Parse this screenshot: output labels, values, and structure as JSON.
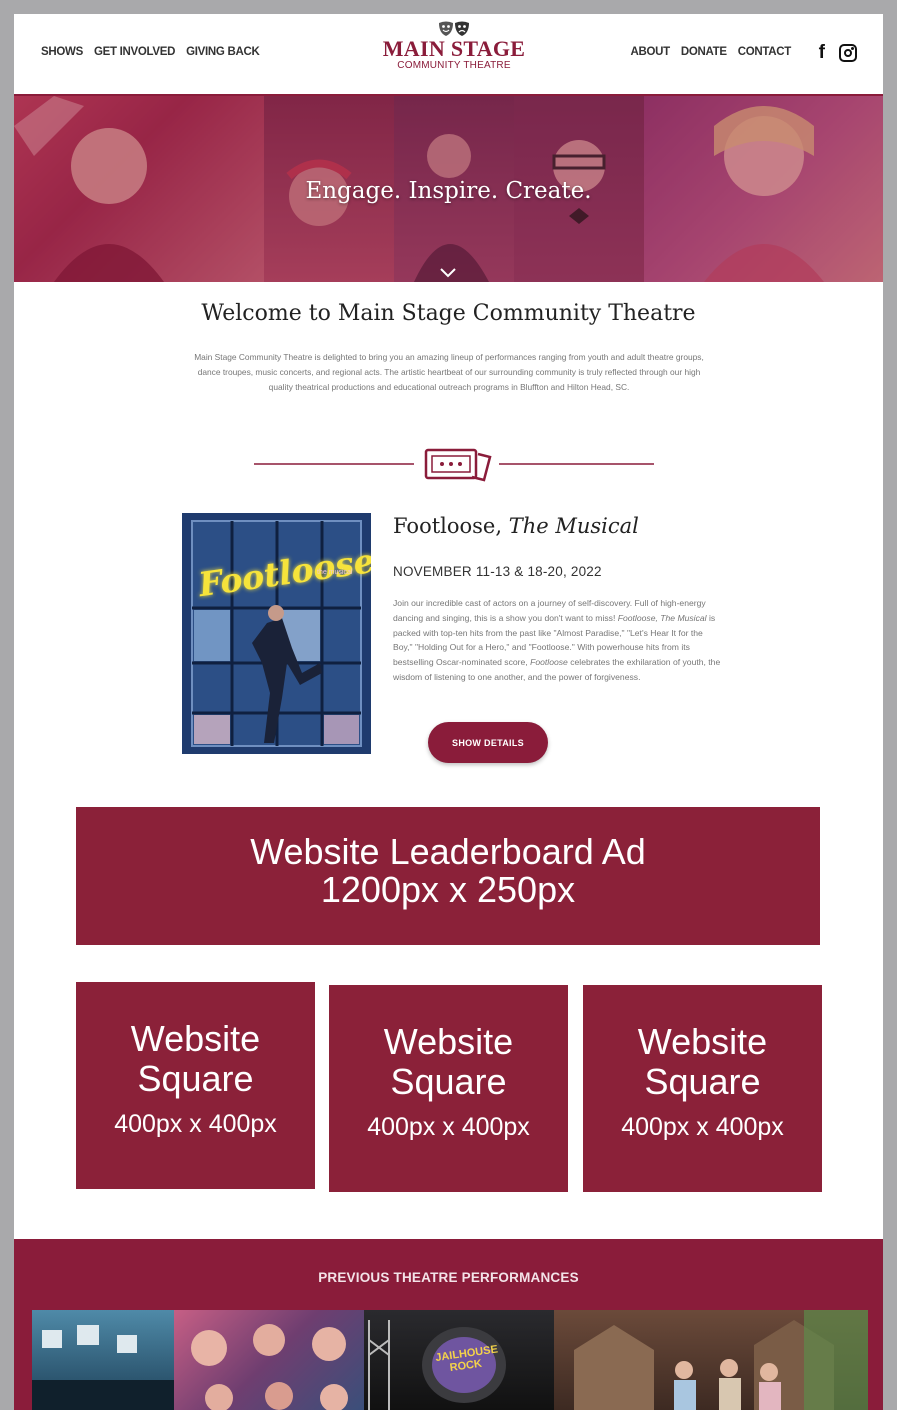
{
  "header": {
    "nav_left": [
      "SHOWS",
      "GET INVOLVED",
      "GIVING BACK"
    ],
    "nav_right": [
      "ABOUT",
      "DONATE",
      "CONTACT"
    ],
    "logo_main": "MAIN STAGE",
    "logo_sub": "COMMUNITY THEATRE",
    "social_icons": [
      "facebook-icon",
      "instagram-icon"
    ]
  },
  "hero": {
    "tagline": "Engage. Inspire. Create."
  },
  "welcome": {
    "title": "Welcome to Main Stage Community Theatre",
    "body": "Main Stage Community Theatre is delighted to bring you an amazing lineup of performances ranging from youth and adult theatre groups, dance troupes, music concerts, and regional acts. The artistic heartbeat of our surrounding community is truly reflected through our high quality theatrical productions and educational outreach programs in Bluffton and Hilton Head, SC."
  },
  "show": {
    "title_plain": "Footloose, ",
    "title_italic": "The Musical",
    "dates": "NOVEMBER 11-13 & 18-20, 2022",
    "desc_1": "Join our incredible cast of actors on a journey of self-discovery. Full of high-energy dancing and singing, this is a show you don't want to miss! ",
    "desc_i1": "Footloose, The Musical",
    "desc_2": " is packed with top-ten hits from the past like \"Almost Paradise,\" \"Let's Hear It for the Boy,\" \"Holding Out for a Hero,\" and \"Footloose.\" With powerhouse hits from its bestselling Oscar-nominated score, ",
    "desc_i2": "Footloose",
    "desc_3": " celebrates the exhilaration of youth, the wisdom of listening to one another, and the power of forgiveness.",
    "button": "SHOW DETAILS",
    "poster_title": "Footloose",
    "poster_sub": "the musical"
  },
  "ads": {
    "leaderboard_line1": "Website Leaderboard Ad",
    "leaderboard_line2": "1200px x 250px",
    "square_title": "Website Square",
    "square_size": "400px x 400px"
  },
  "footer": {
    "title": "PREVIOUS THEATRE PERFORMANCES",
    "gallery_sign": "JAILHOUSE ROCK"
  },
  "colors": {
    "brand": "#8a1c3a",
    "ad_fill": "#8b2139"
  }
}
